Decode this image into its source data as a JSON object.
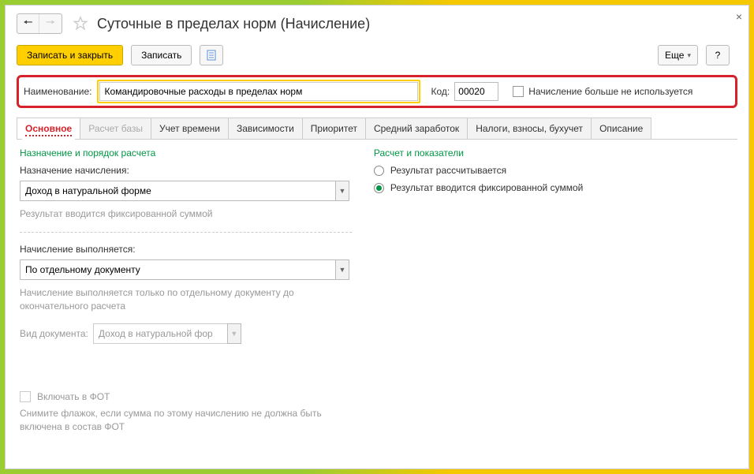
{
  "title": "Суточные в пределах норм (Начисление)",
  "toolbar": {
    "save_close": "Записать и закрыть",
    "save": "Записать",
    "more": "Еще",
    "help": "?"
  },
  "name_row": {
    "label": "Наименование:",
    "value": "Командировочные расходы в пределах норм",
    "code_label": "Код:",
    "code_value": "00020",
    "unused_label": "Начисление больше не используется"
  },
  "tabs": [
    "Основное",
    "Расчет базы",
    "Учет времени",
    "Зависимости",
    "Приоритет",
    "Средний заработок",
    "Налоги, взносы, бухучет",
    "Описание"
  ],
  "left": {
    "section": "Назначение и порядок расчета",
    "assign_label": "Назначение начисления:",
    "assign_value": "Доход в натуральной форме",
    "assign_hint": "Результат вводится фиксированной суммой",
    "exec_label": "Начисление выполняется:",
    "exec_value": "По отдельному документу",
    "exec_hint": "Начисление выполняется только по отдельному документу до окончательного расчета",
    "doc_label": "Вид документа:",
    "doc_value": "Доход в натуральной фор",
    "fot_label": "Включать в ФОТ",
    "fot_hint": "Снимите флажок, если сумма по этому начислению не должна быть включена в состав ФОТ"
  },
  "right": {
    "section": "Расчет и показатели",
    "opt1": "Результат рассчитывается",
    "opt2": "Результат вводится фиксированной суммой"
  }
}
